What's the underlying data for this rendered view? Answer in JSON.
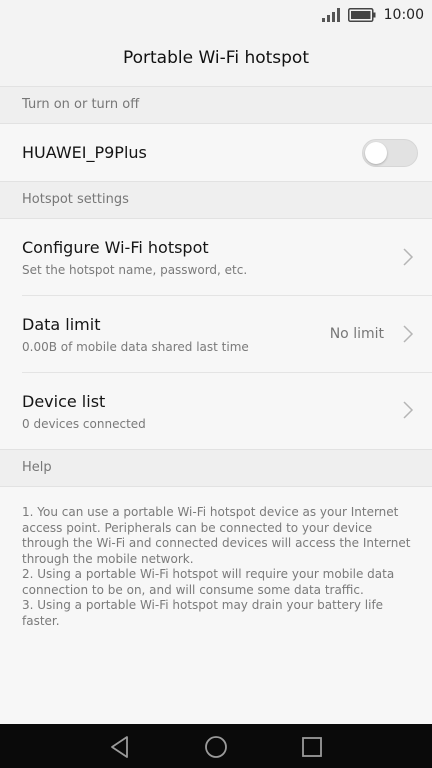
{
  "status_bar": {
    "time": "10:00",
    "signal_icon": "signal-icon",
    "battery_icon": "battery-icon"
  },
  "header": {
    "title": "Portable Wi-Fi hotspot"
  },
  "sections": {
    "toggle_section": "Turn on or turn off",
    "settings_section": "Hotspot settings",
    "help_section": "Help"
  },
  "hotspot_toggle": {
    "label": "HUAWEI_P9Plus",
    "state": "off"
  },
  "settings": {
    "configure": {
      "title": "Configure Wi-Fi hotspot",
      "subtitle": "Set the hotspot name, password, etc."
    },
    "data_limit": {
      "title": "Data limit",
      "subtitle": "0.00B of mobile data shared last time",
      "value": "No limit"
    },
    "device_list": {
      "title": "Device list",
      "subtitle": "0 devices connected"
    }
  },
  "help": {
    "text": "1. You can use a portable Wi-Fi hotspot device as your Internet access point. Peripherals can be connected to your device through the Wi-Fi and connected devices will access the Internet through the mobile network.\n2. Using a portable Wi-Fi hotspot will require your mobile data connection to be on, and will consume some data traffic.\n3. Using a portable Wi-Fi hotspot may drain your battery life faster."
  },
  "nav_bar": {
    "back_icon": "back-icon",
    "home_icon": "home-icon",
    "recents_icon": "recents-icon"
  },
  "colors": {
    "background": "#f7f7f7",
    "section_header": "#efefef",
    "nav_bar": "#0a0a0a"
  }
}
